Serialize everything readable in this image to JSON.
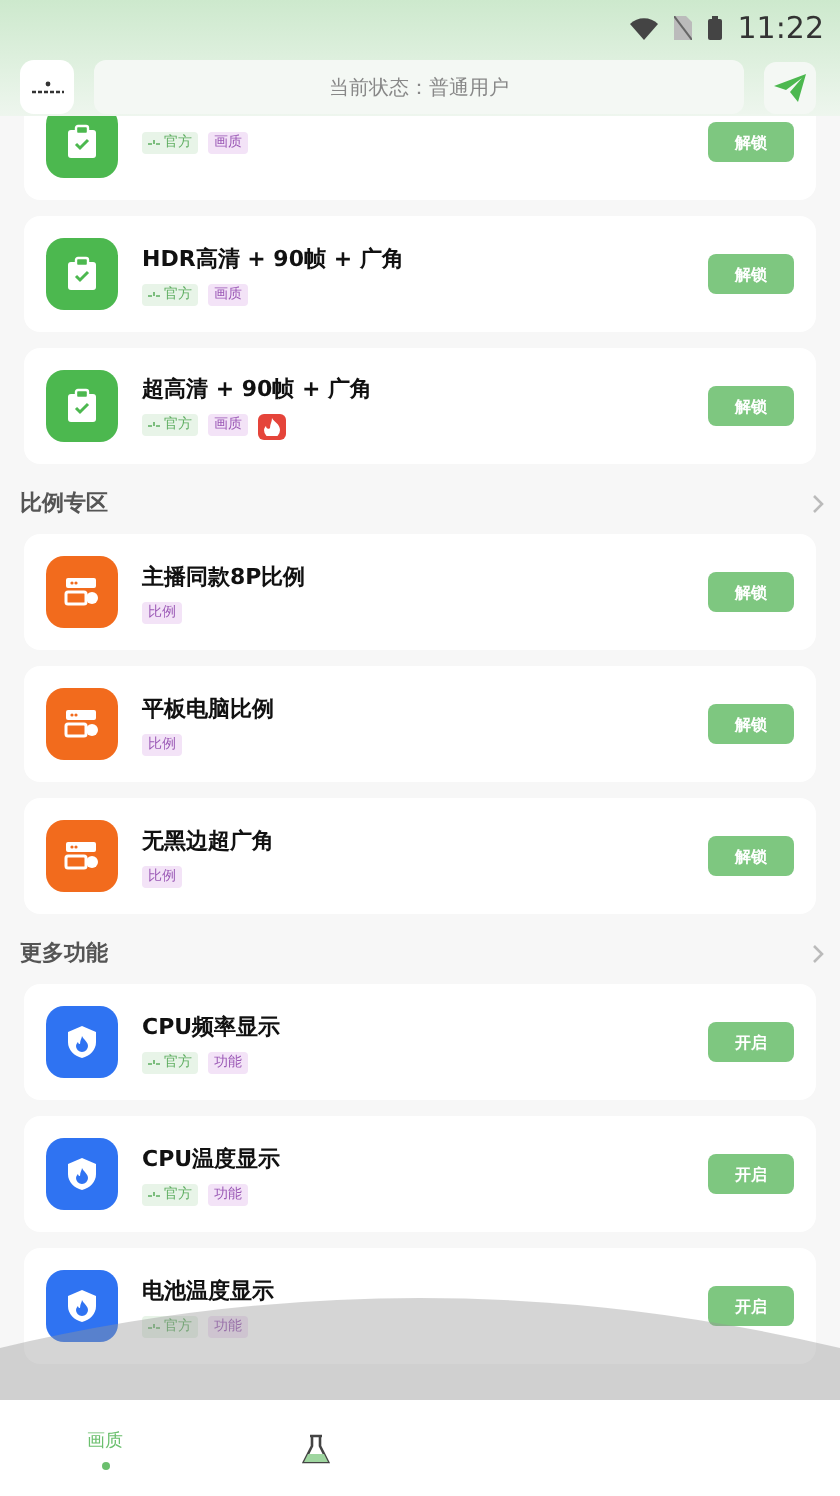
{
  "status_bar": {
    "time": "11:22"
  },
  "header": {
    "status_text": "当前状态：普通用户"
  },
  "sections": [
    {
      "items": [
        {
          "tags": [
            {
              "kind": "official",
              "label": "官方"
            },
            {
              "kind": "category",
              "label": "画质"
            }
          ],
          "button": "解锁"
        },
        {
          "title": "HDR高清 + 90帧 + 广角",
          "tags": [
            {
              "kind": "official",
              "label": "官方"
            },
            {
              "kind": "category",
              "label": "画质"
            }
          ],
          "button": "解锁"
        },
        {
          "title": "超高清 + 90帧 + 广角",
          "tags": [
            {
              "kind": "official",
              "label": "官方"
            },
            {
              "kind": "category",
              "label": "画质"
            },
            {
              "kind": "hot"
            }
          ],
          "button": "解锁"
        }
      ]
    },
    {
      "title": "比例专区",
      "items": [
        {
          "title": "主播同款8P比例",
          "tags": [
            {
              "kind": "category",
              "label": "比例"
            }
          ],
          "button": "解锁"
        },
        {
          "title": "平板电脑比例",
          "tags": [
            {
              "kind": "category",
              "label": "比例"
            }
          ],
          "button": "解锁"
        },
        {
          "title": "无黑边超广角",
          "tags": [
            {
              "kind": "category",
              "label": "比例"
            }
          ],
          "button": "解锁"
        }
      ]
    },
    {
      "title": "更多功能",
      "items": [
        {
          "title": "CPU频率显示",
          "tags": [
            {
              "kind": "official",
              "label": "官方"
            },
            {
              "kind": "category",
              "label": "功能"
            }
          ],
          "button": "开启"
        },
        {
          "title": "CPU温度显示",
          "tags": [
            {
              "kind": "official",
              "label": "官方"
            },
            {
              "kind": "category",
              "label": "功能"
            }
          ],
          "button": "开启"
        },
        {
          "title": "电池温度显示",
          "tags": [
            {
              "kind": "official",
              "label": "官方"
            },
            {
              "kind": "category",
              "label": "功能"
            }
          ],
          "button": "开启"
        }
      ]
    }
  ],
  "nav": [
    {
      "kind": "text",
      "label": "画质",
      "selected": true
    },
    {
      "kind": "flask",
      "selected": false
    }
  ]
}
